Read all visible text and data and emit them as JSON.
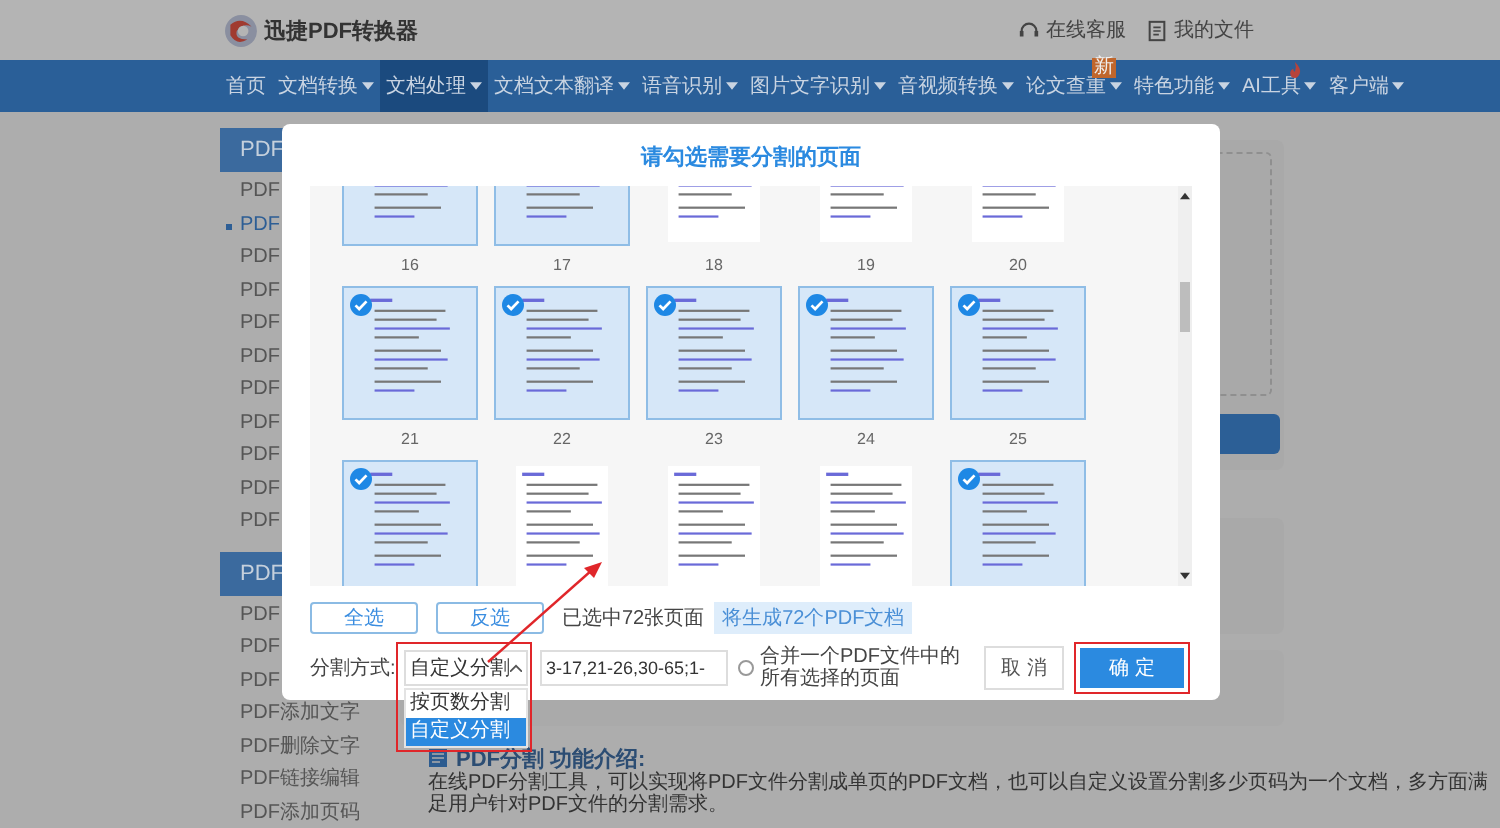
{
  "header": {
    "logo_text": "迅捷PDF转换器",
    "links": [
      {
        "label": "在线客服",
        "kind": "support"
      },
      {
        "label": "我的文件",
        "kind": "files"
      }
    ]
  },
  "nav": [
    {
      "label": "首页",
      "dropdown": false,
      "selected": false
    },
    {
      "label": "文档转换",
      "dropdown": true,
      "selected": false
    },
    {
      "label": "文档处理",
      "dropdown": true,
      "selected": true
    },
    {
      "label": "文档文本翻译",
      "dropdown": true,
      "selected": false
    },
    {
      "label": "语音识别",
      "dropdown": true,
      "selected": false
    },
    {
      "label": "图片文字识别",
      "dropdown": true,
      "selected": false
    },
    {
      "label": "音视频转换",
      "dropdown": true,
      "selected": false
    },
    {
      "label": "论文查重",
      "dropdown": true,
      "selected": false,
      "badge": "新"
    },
    {
      "label": "特色功能",
      "dropdown": true,
      "selected": false
    },
    {
      "label": "AI工具",
      "dropdown": true,
      "selected": false,
      "hot": true
    },
    {
      "label": "客户端",
      "dropdown": true,
      "selected": false
    }
  ],
  "sidebar": [
    {
      "title": "PDF",
      "items": [
        {
          "label": "PDF",
          "selected": false
        },
        {
          "label": "PDF",
          "selected": true
        },
        {
          "label": "PDF",
          "selected": false
        },
        {
          "label": "PDF",
          "selected": false
        },
        {
          "label": "PDF",
          "selected": false
        },
        {
          "label": "PDF",
          "selected": false
        },
        {
          "label": "PDF",
          "selected": false
        },
        {
          "label": "PDF",
          "selected": false
        },
        {
          "label": "PDF",
          "selected": false
        },
        {
          "label": "PDF",
          "selected": false
        },
        {
          "label": "PDF",
          "selected": false
        }
      ]
    },
    {
      "title": "PDF",
      "items": [
        {
          "label": "PDF",
          "selected": false
        },
        {
          "label": "PDF",
          "selected": false
        },
        {
          "label": "PDF",
          "selected": false
        },
        {
          "label": "PDF添加文字",
          "selected": false
        },
        {
          "label": "PDF删除文字",
          "selected": false
        },
        {
          "label": "PDF链接编辑",
          "selected": false
        },
        {
          "label": "PDF添加页码",
          "selected": false
        }
      ]
    }
  ],
  "intro": {
    "title": "PDF分割 功能介绍:",
    "text": "在线PDF分割工具，可以实现将PDF文件分割成单页的PDF文档，也可以自定义设置分割多少页码为一个文档，多方面满足用户针对PDF文件的分割需求。"
  },
  "modal": {
    "title": "请勾选需要分割的页面",
    "pages": [
      {
        "number": "16",
        "selected": true
      },
      {
        "number": "17",
        "selected": true
      },
      {
        "number": "18",
        "selected": false
      },
      {
        "number": "19",
        "selected": false
      },
      {
        "number": "20",
        "selected": false
      },
      {
        "number": "21",
        "selected": true
      },
      {
        "number": "22",
        "selected": true
      },
      {
        "number": "23",
        "selected": true
      },
      {
        "number": "24",
        "selected": true
      },
      {
        "number": "25",
        "selected": true
      },
      {
        "selected": true
      },
      {
        "selected": false
      },
      {
        "selected": false
      },
      {
        "selected": false
      },
      {
        "selected": true
      }
    ],
    "select_all": "全选",
    "invert": "反选",
    "selected_count": "已选中72张页面",
    "result_tag": "将生成72个PDF文档",
    "split_label": "分割方式:",
    "split_mode": {
      "value": "自定义分割",
      "options": [
        {
          "label": "按页数分割",
          "selected": false
        },
        {
          "label": "自定义分割",
          "selected": true
        }
      ]
    },
    "range_input": {
      "value": "3-17,21-26,30-65;1-"
    },
    "merge_option": {
      "label": "合并一个PDF文件中的所有选择的页面",
      "checked": false
    },
    "cancel": "取 消",
    "confirm": "确 定"
  }
}
